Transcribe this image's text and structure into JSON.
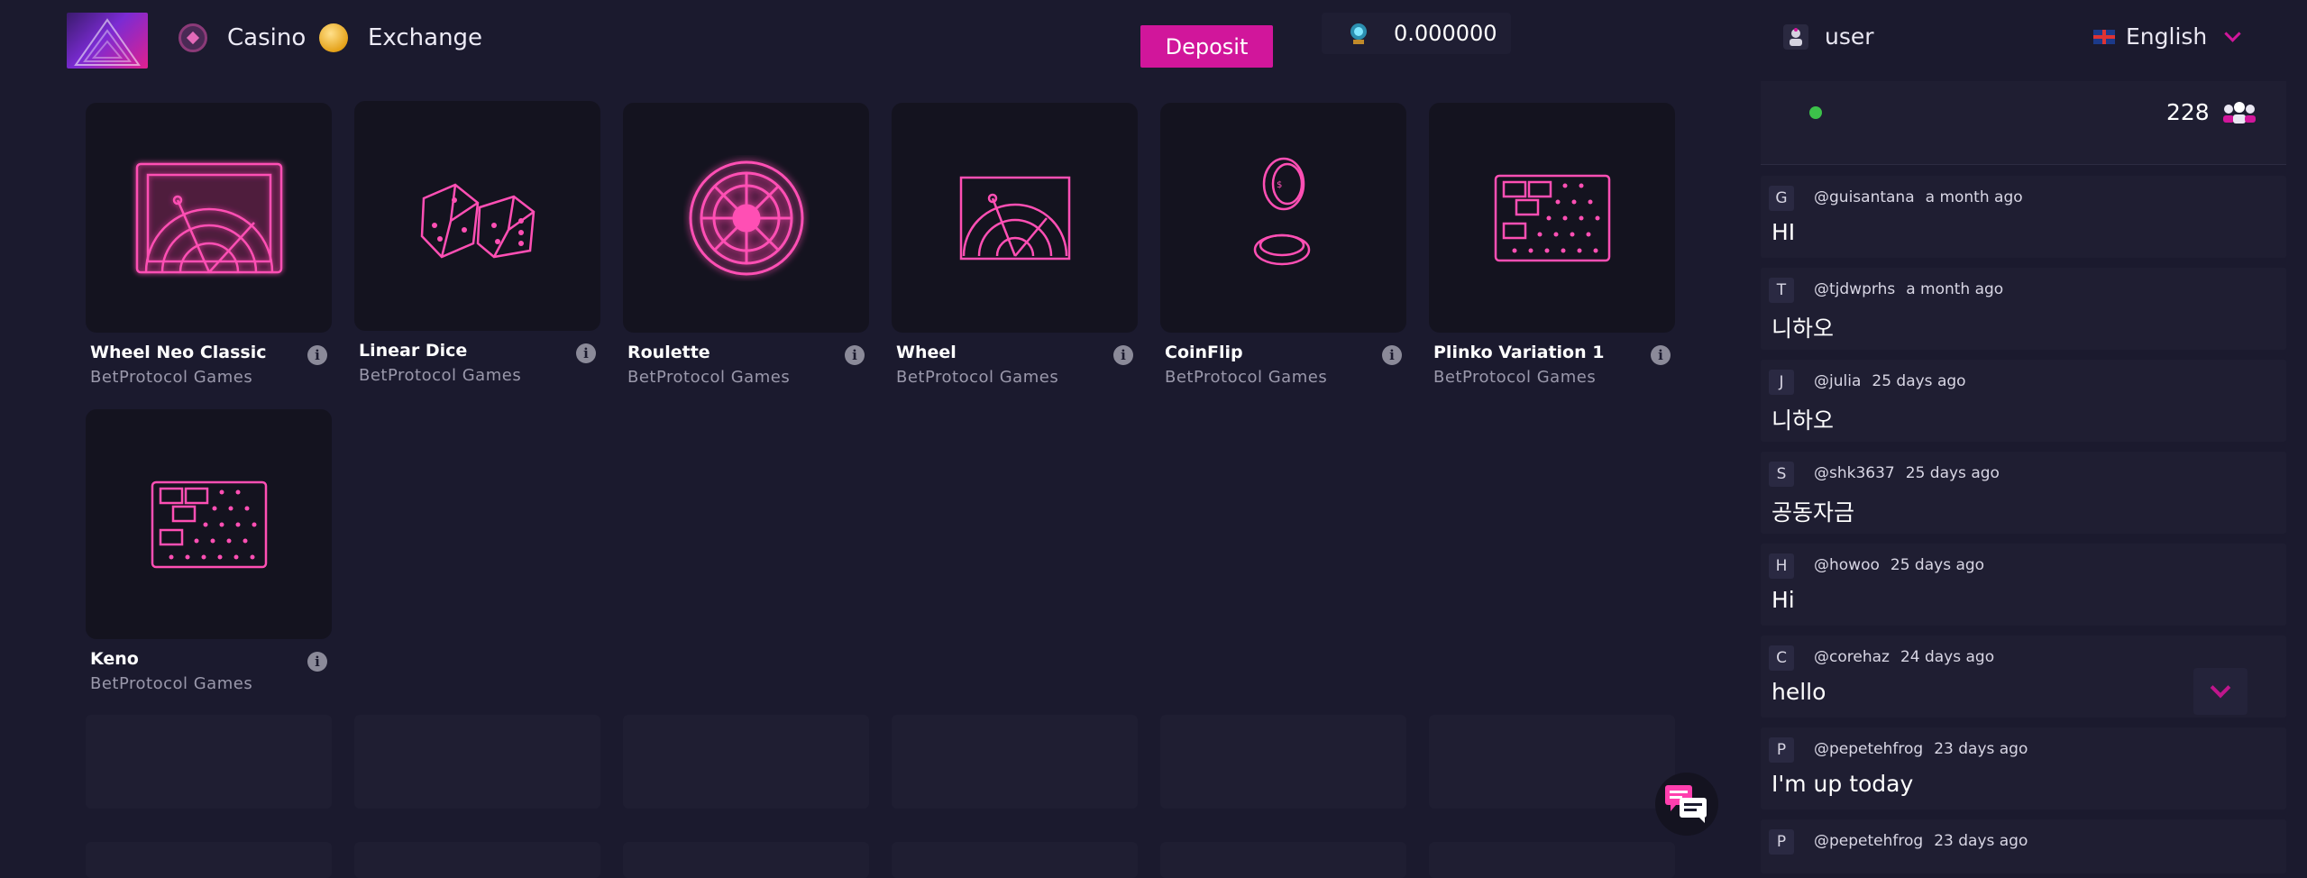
{
  "header": {
    "nav": [
      {
        "label": "Casino",
        "icon": "casino-icon"
      },
      {
        "label": "Exchange",
        "icon": "exchange-coin-icon"
      }
    ],
    "deposit_label": "Deposit",
    "balance": "0.000000",
    "username": "user",
    "language": "English"
  },
  "games": [
    {
      "name": "Wheel Neo Classic",
      "provider": "BetProtocol Games",
      "icon": "wheel-neo-classic-icon"
    },
    {
      "name": "Linear Dice",
      "provider": "BetProtocol Games",
      "icon": "dice-icon"
    },
    {
      "name": "Roulette",
      "provider": "BetProtocol Games",
      "icon": "roulette-icon"
    },
    {
      "name": "Wheel",
      "provider": "BetProtocol Games",
      "icon": "wheel-icon"
    },
    {
      "name": "CoinFlip",
      "provider": "BetProtocol Games",
      "icon": "coinflip-icon"
    },
    {
      "name": "Plinko Variation 1",
      "provider": "BetProtocol Games",
      "icon": "plinko-icon"
    },
    {
      "name": "Keno",
      "provider": "BetProtocol Games",
      "icon": "keno-icon"
    }
  ],
  "chat": {
    "online_count": "228",
    "messages": [
      {
        "initial": "G",
        "user": "@guisantana",
        "time": "a month ago",
        "text": "HI"
      },
      {
        "initial": "T",
        "user": "@tjdwprhs",
        "time": "a month ago",
        "text": "니하오"
      },
      {
        "initial": "J",
        "user": "@julia",
        "time": "25 days ago",
        "text": "니하오"
      },
      {
        "initial": "S",
        "user": "@shk3637",
        "time": "25 days ago",
        "text": "공동자금"
      },
      {
        "initial": "H",
        "user": "@howoo",
        "time": "25 days ago",
        "text": "Hi"
      },
      {
        "initial": "C",
        "user": "@corehaz",
        "time": "24 days ago",
        "text": "hello"
      },
      {
        "initial": "P",
        "user": "@pepetehfrog",
        "time": "23 days ago",
        "text": "I'm up today"
      },
      {
        "initial": "P",
        "user": "@pepetehfrog",
        "time": "23 days ago",
        "text": ""
      }
    ]
  },
  "colors": {
    "accent": "#d1169b",
    "neon": "#ff3fae",
    "background": "#1b1a2e",
    "panel": "#1f1e32"
  }
}
